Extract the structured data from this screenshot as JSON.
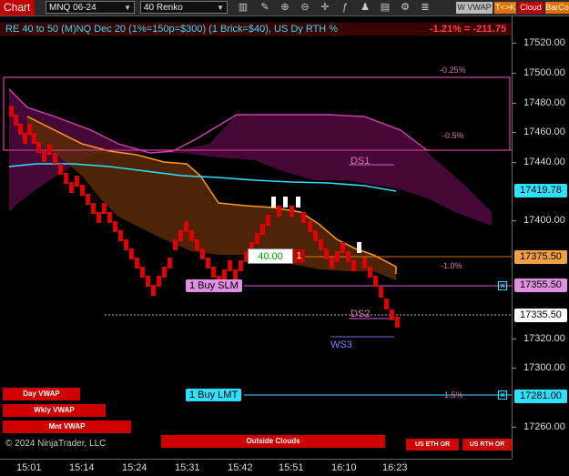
{
  "toolbar": {
    "chart_label": "Chart",
    "instrument": "MNQ 06-24",
    "bar_type": "40 Renko",
    "icons": [
      "bar-style-icon",
      "draw-tools-icon",
      "zoom-in-icon",
      "zoom-out-icon",
      "crosshair-icon",
      "indicators-icon",
      "strategies-icon",
      "templates-icon",
      "properties-icon",
      "layers-icon"
    ],
    "buttons": {
      "w_vwap": "W VWAP",
      "tk": "T<>K",
      "cloud": "Cloud",
      "barco": "BarCo"
    }
  },
  "header": {
    "title": "RE 40 to 50 (M)NQ Dec 20 (1%=150p=$300) (1 Brick=$40), US Dy RTH %",
    "change": "-1.21% = -211.75"
  },
  "y_axis": {
    "ticks": [
      "17520.00",
      "17500.00",
      "17480.00",
      "17460.00",
      "17440.00",
      "17400.00",
      "17320.00",
      "17300.00",
      "17260.00"
    ],
    "price_labels": {
      "cyan_line": "17419.78",
      "orange_line": "17375.50",
      "buy_slm": "17355.50",
      "last": "17335.50",
      "buy_lmt": "17281.00"
    }
  },
  "x_axis": {
    "ticks": [
      "15:01",
      "15:14",
      "15:24",
      "15:31",
      "15:42",
      "15:51",
      "16:10",
      "16:23"
    ]
  },
  "annotations": {
    "pct_025": "-0.25%",
    "pct_05": "-0.5%",
    "pct_10": "-1.0%",
    "pct_15": "1.5%",
    "ds1": "DS1",
    "ds2": "DS2",
    "ws3": "WS3"
  },
  "orders": {
    "buy_slm": "1 Buy SLM",
    "buy_lmt": "1 Buy LMT",
    "qty_value": "40.00",
    "qty_count": "1",
    "cancel_glyph": "✕"
  },
  "bottom_buttons": {
    "day_vwap": "Day VWAP",
    "wkly_vwap": "Wkly VWAP",
    "mnt_vwap": "Mnt VWAP",
    "outside_clouds": "Outside Clouds",
    "us_eth_or": "US ETH OR",
    "us_rth_or": "US RTH OR",
    "copyright": "© 2024 NinjaTrader, LLC"
  },
  "colors": {
    "brick_down": "#e00000",
    "brick_up": "#ffffff",
    "cyan": "#30e0ff",
    "orange": "#ff9a1a",
    "magenta": "#d040b0",
    "cloud_fill": "#4a0a3a"
  }
}
